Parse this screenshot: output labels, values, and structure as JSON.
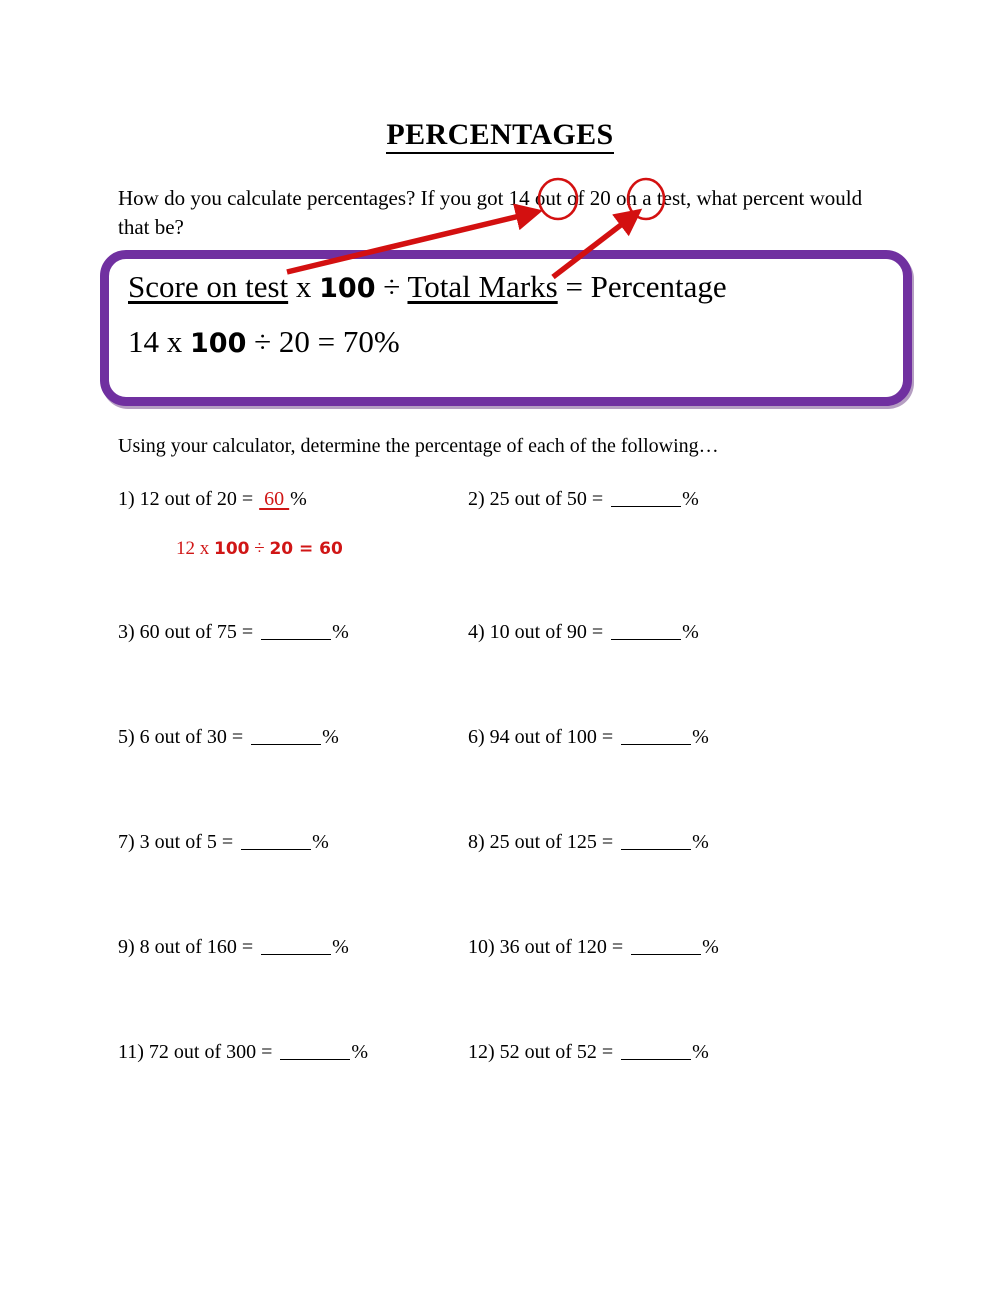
{
  "document": {
    "title": "PERCENTAGES",
    "intro": "How do you calculate percentages? If you got 14 out of 20 on a test, what percent would that be?",
    "instruction": "Using your calculator, determine the percentage of each of the following…"
  },
  "formula_box": {
    "line1": {
      "part_score": "Score on test",
      "part_times": " x ",
      "part_100": "100",
      "part_div": " ÷ ",
      "part_total": "Total Marks",
      "part_result": " = Percentage"
    },
    "line2": {
      "part_a": "14 x ",
      "part_100": "100",
      "part_b": " ÷ 20 = 70%"
    },
    "border_color": "#7030a0"
  },
  "annotations": {
    "circle_1_label": "14",
    "circle_2_label": "20",
    "arrow_color": "#d31010",
    "circle_color": "#d31010"
  },
  "questions": [
    {
      "number": "1)",
      "text": "12 out of 20 =",
      "answer": "60",
      "answered": true,
      "percent": "%"
    },
    {
      "number": "2)",
      "text": "25 out of 50 =",
      "answer": "",
      "answered": false,
      "percent": "%"
    },
    {
      "number": "3)",
      "text": "60 out of 75 =",
      "answer": "",
      "answered": false,
      "percent": "%"
    },
    {
      "number": "4)",
      "text": "10 out of 90 =",
      "answer": "",
      "answered": false,
      "percent": "%"
    },
    {
      "number": "5)",
      "text": "6 out of 30 =",
      "answer": "",
      "answered": false,
      "percent": "%"
    },
    {
      "number": "6)",
      "text": "94 out of 100 =",
      "answer": "",
      "answered": false,
      "percent": "%"
    },
    {
      "number": "7)",
      "text": "3 out of 5 =",
      "answer": "",
      "answered": false,
      "percent": "%"
    },
    {
      "number": "8)",
      "text": "25 out of 125 =",
      "answer": "",
      "answered": false,
      "percent": "%"
    },
    {
      "number": "9)",
      "text": "8 out of 160 =",
      "answer": "",
      "answered": false,
      "percent": "%"
    },
    {
      "number": "10)",
      "text": "36 out of 120 =",
      "answer": "",
      "answered": false,
      "percent": "%"
    },
    {
      "number": "11)",
      "text": "72 out of 300 =",
      "answer": "",
      "answered": false,
      "percent": "%"
    },
    {
      "number": "12)",
      "text": "52 out of 52 =",
      "answer": "",
      "answered": false,
      "percent": "%"
    }
  ],
  "worked_example": {
    "part_a": "12 x ",
    "part_100": "100",
    "part_b": " ÷ ",
    "part_c": "20 = 60",
    "color": "#d01616"
  }
}
